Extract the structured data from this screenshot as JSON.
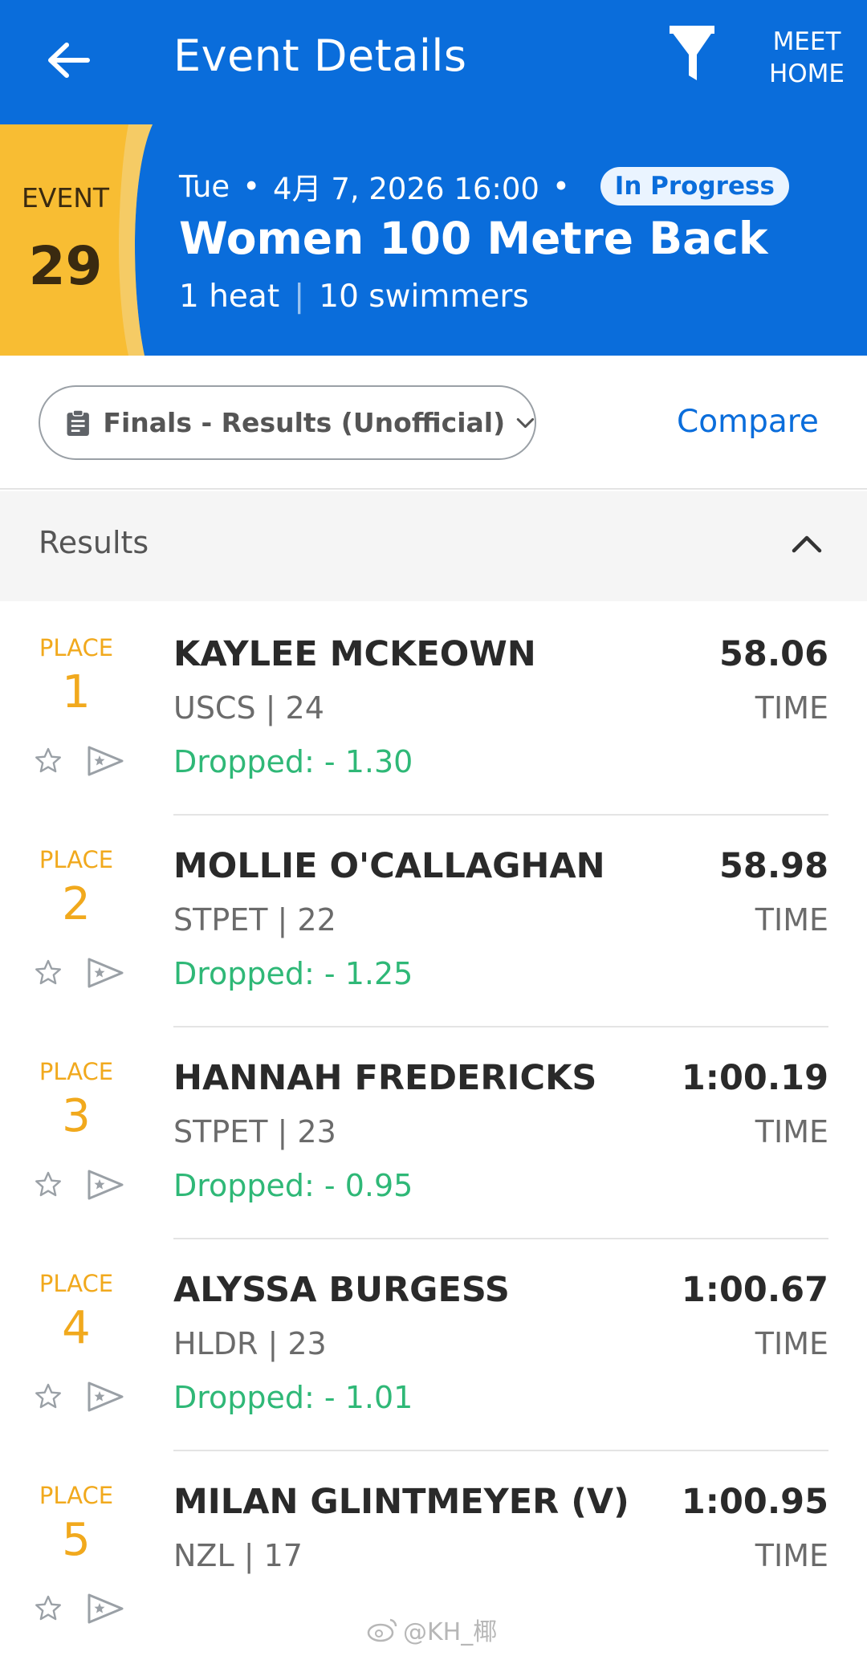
{
  "appbar": {
    "title": "Event Details",
    "meet_home": "MEET HOME"
  },
  "event": {
    "label": "EVENT",
    "number": "29",
    "day": "Tue",
    "datetime": "4月 7, 2026 16:00",
    "status": "In Progress",
    "name": "Women 100 Metre Back",
    "heats": "1 heat",
    "swimmers": "10 swimmers"
  },
  "filters": {
    "round": "Finals - Results (Unofficial)",
    "compare": "Compare"
  },
  "results": {
    "title": "Results",
    "place_label": "PLACE",
    "time_label": "TIME",
    "rows": [
      {
        "place": "1",
        "name": "KAYLEE MCKEOWN",
        "team": "USCS | 24",
        "time": "58.06",
        "dropped": "Dropped: - 1.30"
      },
      {
        "place": "2",
        "name": "MOLLIE O'CALLAGHAN",
        "team": "STPET | 22",
        "time": "58.98",
        "dropped": "Dropped: - 1.25"
      },
      {
        "place": "3",
        "name": "HANNAH FREDERICKS",
        "team": "STPET | 23",
        "time": "1:00.19",
        "dropped": "Dropped: - 0.95"
      },
      {
        "place": "4",
        "name": "ALYSSA BURGESS",
        "team": "HLDR | 23",
        "time": "1:00.67",
        "dropped": "Dropped: - 1.01"
      },
      {
        "place": "5",
        "name": "MILAN GLINTMEYER (V)",
        "team": "NZL | 17",
        "time": "1:00.95",
        "dropped": ""
      }
    ]
  },
  "watermark": "@KH_椰",
  "colors": {
    "primary": "#0a6ddb",
    "badge": "#f8bd33",
    "place": "#f1a91d",
    "dropped": "#2fb877"
  }
}
